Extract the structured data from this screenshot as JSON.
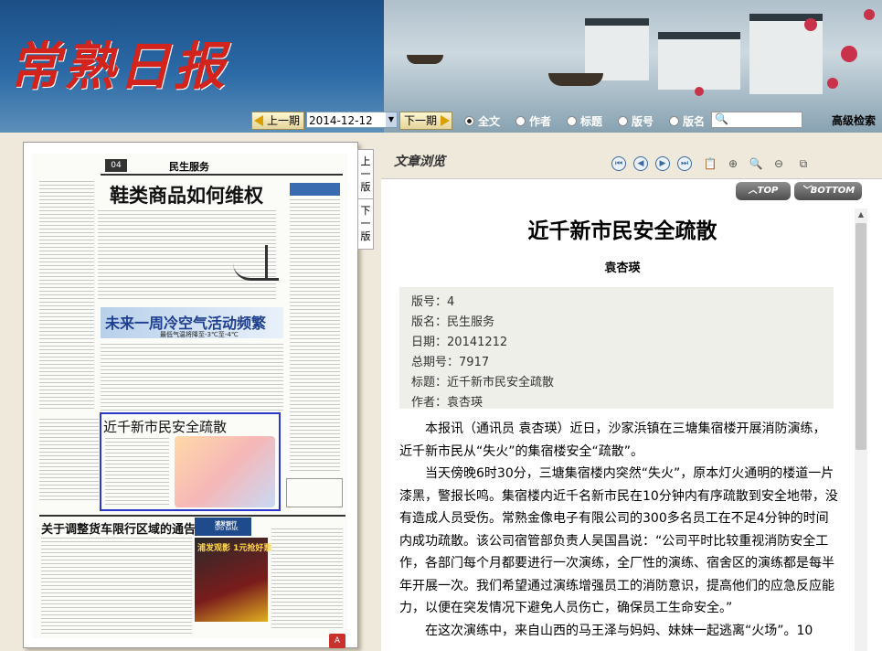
{
  "header": {
    "logo_text": "常熟日报",
    "prev_label": "上一期",
    "date_value": "2014-12-12",
    "next_label": "下一期",
    "search_options": [
      "全文",
      "作者",
      "标题",
      "版号",
      "版名"
    ],
    "selected_option": "全文",
    "search_placeholder": "",
    "advanced_label": "高级检索"
  },
  "page_nav": {
    "prev_page": "上一版",
    "next_page": "下一版"
  },
  "newspaper": {
    "page_label": "04",
    "section": "民生服务",
    "headline1": "鞋类商品如何维权",
    "headline2": "未来一周冷空气活动频繁",
    "subhead2": "最低气温将降至-3℃至-4℃",
    "headline3": "近千新市民安全疏散",
    "headline4": "关于调整货车限行区域的通告",
    "bank_name": "浦发银行",
    "bank_en": "SPD BANK",
    "ad_text": "浦发观影 1元抢好票"
  },
  "viewer": {
    "title": "文章浏览",
    "top_label": "TOP",
    "bottom_label": "BOTTOM",
    "article_title": "近千新市民安全疏散",
    "author": "袁杏瑛",
    "meta": [
      {
        "label": "版号",
        "value": "4"
      },
      {
        "label": "版名",
        "value": "民生服务"
      },
      {
        "label": "日期",
        "value": "20141212"
      },
      {
        "label": "总期号",
        "value": "7917"
      },
      {
        "label": "标题",
        "value": "近千新市民安全疏散"
      },
      {
        "label": "作者",
        "value": "袁杏瑛"
      }
    ],
    "paragraphs": [
      "本报讯（通讯员 袁杏瑛）近日，沙家浜镇在三塘集宿楼开展消防演练，近千新市民从“失火”的集宿楼安全“疏散”。",
      "当天傍晚6时30分，三塘集宿楼内突然“失火”，原本灯火通明的楼道一片漆黑，警报长鸣。集宿楼内近千名新市民在10分钟内有序疏散到安全地带，没有造成人员受伤。常熟金像电子有限公司的300多名员工在不足4分钟的时间内成功疏散。该公司宿管部负责人吴国昌说：“公司平时比较重视消防安全工作，各部门每个月都要进行一次演练，全厂性的演练、宿舍区的演练都是每半年开展一次。我们希望通过演练增强员工的消防意识，提高他们的应急反应能力，以便在突发情况下避免人员伤亡，确保员工生命安全。”",
      "在这次演练中，来自山西的马王泽与妈妈、妹妹一起逃离“火场”。10"
    ]
  }
}
